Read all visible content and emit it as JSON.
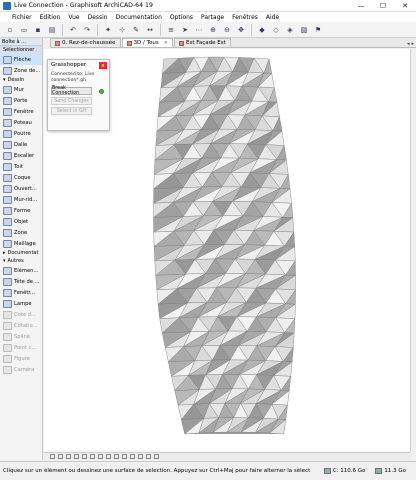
{
  "window": {
    "title": "Live Connection - Graphisoft ArchiCAD-64 19",
    "minimize_glyph": "—",
    "maximize_glyph": "☐",
    "close_glyph": "✕"
  },
  "menu": [
    "Fichier",
    "Edition",
    "Vue",
    "Dessin",
    "Documentation",
    "Options",
    "Partage",
    "Fenêtres",
    "Aide"
  ],
  "tabs": [
    {
      "label": "0. Rez-de-chaussée",
      "active": false
    },
    {
      "label": "3D / Tous",
      "active": true
    },
    {
      "label": "Est Façade Est",
      "active": false
    }
  ],
  "toolbox": {
    "header": "Boîte à ...",
    "select_label": "Sélectionner",
    "items_top": [
      {
        "label": "Flèche",
        "selected": true
      },
      {
        "label": "Zone de...",
        "selected": false
      }
    ],
    "dessin_group": "Dessin",
    "items_design": [
      {
        "label": "Mur",
        "disabled": false
      },
      {
        "label": "Porte",
        "disabled": false
      },
      {
        "label": "Fenêtre",
        "disabled": false
      },
      {
        "label": "Poteau",
        "disabled": false
      },
      {
        "label": "Poutre",
        "disabled": false
      },
      {
        "label": "Dalle",
        "disabled": false
      },
      {
        "label": "Escalier",
        "disabled": false
      },
      {
        "label": "Toit",
        "disabled": false
      },
      {
        "label": "Coque",
        "disabled": false
      },
      {
        "label": "Ouvert...",
        "disabled": false
      },
      {
        "label": "Mur-rid...",
        "disabled": false
      },
      {
        "label": "Forme",
        "disabled": false
      },
      {
        "label": "Objet",
        "disabled": false
      },
      {
        "label": "Zone",
        "disabled": false
      },
      {
        "label": "Maillage",
        "disabled": false
      }
    ],
    "documentat_group": "Documentat",
    "autres_group": "Autres",
    "items_other": [
      {
        "label": "Elémen...",
        "disabled": false
      },
      {
        "label": "Tête de ...",
        "disabled": false
      },
      {
        "label": "Fenêtr...",
        "disabled": false
      },
      {
        "label": "Lampe",
        "disabled": false
      },
      {
        "label": "Cote d...",
        "disabled": true
      },
      {
        "label": "Cotatio...",
        "disabled": true
      },
      {
        "label": "Spline",
        "disabled": true
      },
      {
        "label": "Point c...",
        "disabled": true
      },
      {
        "label": "Figure",
        "disabled": true
      },
      {
        "label": "Caméra",
        "disabled": true
      }
    ]
  },
  "grasshopper": {
    "title": "Grasshopper",
    "close_glyph": "x",
    "connected_line1": "Connected to: Live",
    "connected_line2": "connection*.gh",
    "break_button": "Break Connection",
    "send_button": "Send Changes",
    "select_button": "Select in GH"
  },
  "status": {
    "message": "Cliquez sur un élément ou dessinez une surface de sélection. Appuyez sur Ctrl+Maj pour faire alterner la sélect",
    "disk_c": "C: 110.6 Go",
    "disk_other": "11.3 Go"
  },
  "colors": {
    "accent": "#2a6fb5",
    "close_red": "#d9342b",
    "connected_green": "#3cbf3c",
    "selection_blue": "#cfe3f7"
  }
}
